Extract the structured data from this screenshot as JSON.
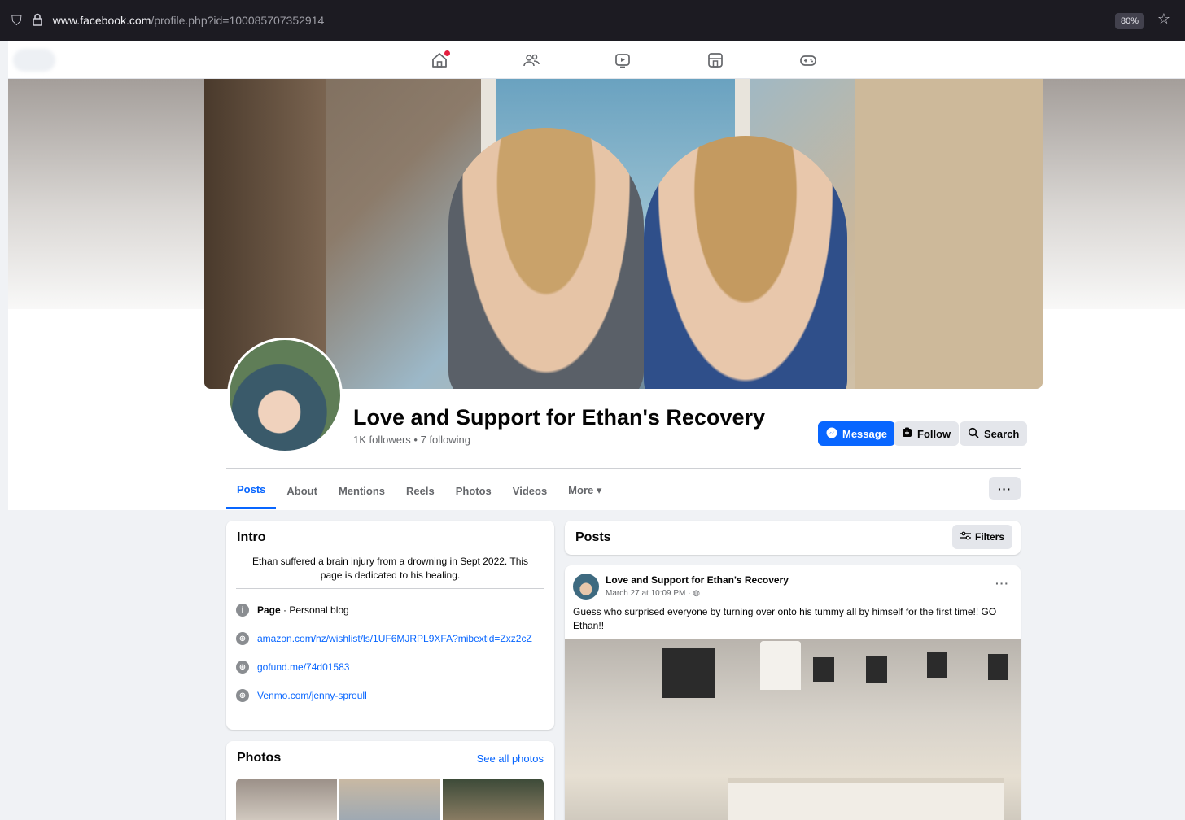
{
  "browser": {
    "url_domain": "www.facebook.com",
    "url_path": "/profile.php?id=100085707352914",
    "zoom": "80%"
  },
  "profile": {
    "name": "Love and Support for Ethan's Recovery",
    "stats": "1K followers • 7 following",
    "buttons": {
      "message": "Message",
      "follow": "Follow",
      "search": "Search"
    },
    "more_dots": "···"
  },
  "tabs": [
    {
      "label": "Posts",
      "active": true
    },
    {
      "label": "About"
    },
    {
      "label": "Mentions"
    },
    {
      "label": "Reels"
    },
    {
      "label": "Photos"
    },
    {
      "label": "Videos"
    },
    {
      "label": "More ▾"
    }
  ],
  "intro": {
    "title": "Intro",
    "bio": "Ethan suffered a brain injury from a drowning in Sept 2022. This page is dedicated to his healing.",
    "category_label": "Page",
    "category": " · Personal blog",
    "links": [
      "amazon.com/hz/wishlist/ls/1UF6MJRPL9XFA?mibextid=Zxz2cZ",
      "gofund.me/74d01583",
      "Venmo.com/jenny-sproull"
    ]
  },
  "photos_card": {
    "title": "Photos",
    "see_all": "See all photos"
  },
  "posts_header": {
    "title": "Posts",
    "filters": "Filters"
  },
  "post": {
    "author": "Love and Support for Ethan's Recovery",
    "time": "March 27 at 10:09 PM ·",
    "text": "Guess who surprised everyone by turning over onto his tummy all by himself for the first time!! GO Ethan!!"
  }
}
